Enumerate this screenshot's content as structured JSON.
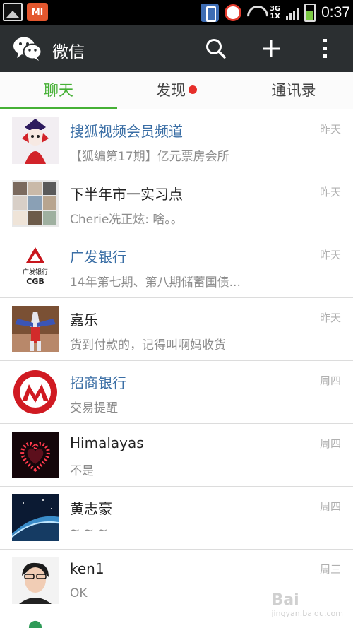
{
  "status_bar": {
    "network": [
      "3G",
      "1X"
    ],
    "time": "0:37",
    "launcher_logo_text": "MI"
  },
  "header": {
    "title": "微信",
    "icons": [
      "wechat-logo-icon",
      "search-icon",
      "plus-icon",
      "more-vertical-icon"
    ]
  },
  "tabs": [
    {
      "label": "聊天",
      "active": true
    },
    {
      "label": "发现",
      "badge": "red-dot"
    },
    {
      "label": "通讯录"
    }
  ],
  "chats": [
    {
      "name": "搜狐视频会员频道",
      "preview": "【狐编第17期】亿元票房会所",
      "time": "昨天",
      "official": true
    },
    {
      "name": "下半年市一实习点",
      "preview": "Cherie冼正炫: 啥。。",
      "time": "昨天",
      "official": false
    },
    {
      "name": "广发银行",
      "preview": "14年第七期、第八期储蓄国债...",
      "time": "昨天",
      "official": true,
      "avatar_text": [
        "广发银行",
        "CGB"
      ]
    },
    {
      "name": "嘉乐",
      "preview": "货到付款的，记得叫啊妈收货",
      "time": "昨天",
      "official": false
    },
    {
      "name": "招商银行",
      "preview": "交易提醒",
      "time": "周四",
      "official": true
    },
    {
      "name": "Himalayas",
      "preview": "不是",
      "time": "周四",
      "official": false
    },
    {
      "name": "黄志豪",
      "preview": "~ ~ ~",
      "time": "周四",
      "official": false
    },
    {
      "name": "ken1",
      "preview": "OK",
      "time": "周三",
      "official": false
    }
  ],
  "colors": {
    "accent_green": "#45b035",
    "header_bg": "#2b2f31",
    "official_name": "#3a6ea5",
    "badge_red": "#e62e2a"
  },
  "watermark": {
    "text": "Bai",
    "sub": "jingyan.baidu.com"
  }
}
